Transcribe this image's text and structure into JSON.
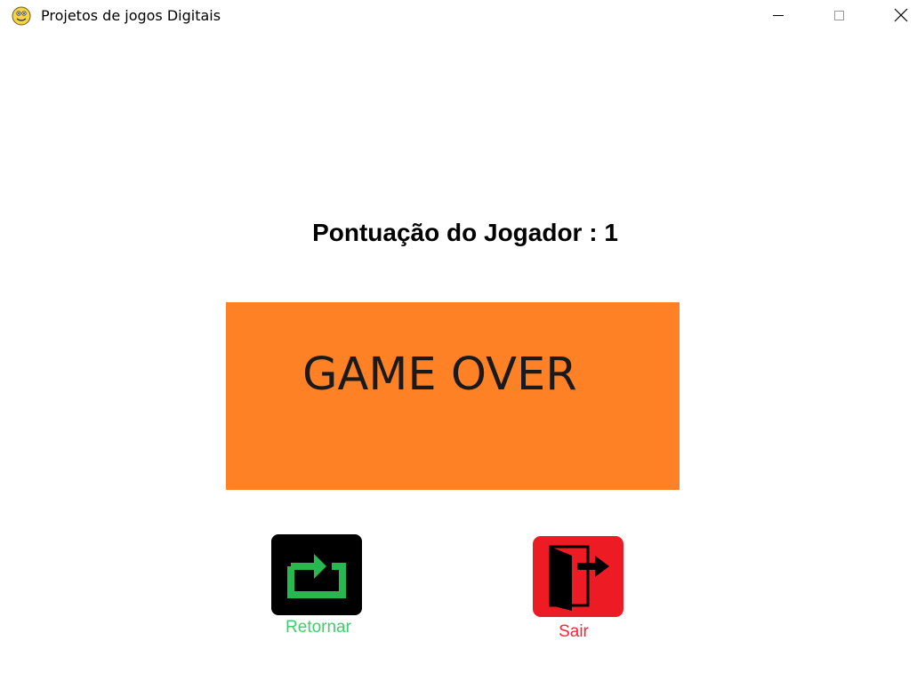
{
  "window": {
    "title": "Projetos de jogos Digitais",
    "icon": "python-snake-icon",
    "controls": [
      "minimize-icon",
      "maximize-icon",
      "close-icon"
    ]
  },
  "game": {
    "score_text": "Pontuação do Jogador : 1",
    "game_over_text": "GAME OVER",
    "colors": {
      "panel": "#ff8126",
      "retry_bg": "#000000",
      "retry_icon": "#27b84f",
      "retry_label": "#3fcf68",
      "exit_bg": "#ed1c24",
      "exit_label": "#ee2a3a"
    },
    "buttons": {
      "retry_label": "Retornar",
      "retry_icon": "repeat-arrow-icon",
      "exit_label": "Sair",
      "exit_icon": "exit-door-icon"
    }
  }
}
